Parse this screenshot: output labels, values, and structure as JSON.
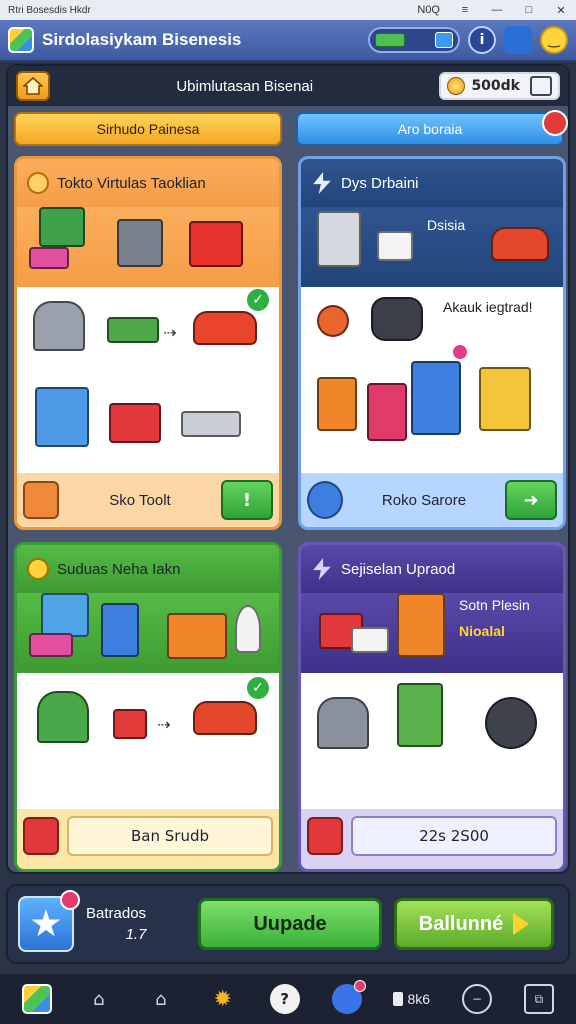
{
  "window": {
    "title": "Rtri Bosesdis Hkdr",
    "controls": [
      "N0Q",
      "≡",
      "—",
      "□",
      "✕"
    ]
  },
  "app": {
    "title": "Sirdolasiykam Bisenesis"
  },
  "subheader": {
    "title": "Ubimlutasan Bisenai",
    "coins": "500dk"
  },
  "tabs": {
    "left": "Sirhudo Painesa",
    "right": "Aro boraia"
  },
  "cards": [
    {
      "title": "Tokto Virtulas Taoklian",
      "footer_label": "Sko Toolt",
      "footer_button": "!"
    },
    {
      "title": "Dys Drbaini",
      "label_1": "Dsisia",
      "label_2": "Akauk iegtrad!",
      "footer_label": "Roko Sarore",
      "footer_button": "➜"
    },
    {
      "title": "Suduas Neha Iakn",
      "footer_label": "Ban Srudb"
    },
    {
      "title": "Sejiselan Upraod",
      "label_1": "Sotn Plesin",
      "label_2": "Nioalal",
      "footer_label": "22s 2S00"
    }
  ],
  "actionbar": {
    "stat_label": "Batrados",
    "stat_value": "1.7",
    "upgrade_label": "Uupade",
    "balance_label": "Ballunné"
  },
  "taskbar": {
    "count_label": "8k6"
  },
  "colors": {
    "accent_orange": "#f59c46",
    "accent_blue": "#2f5590",
    "accent_green": "#3e9b33",
    "accent_purple": "#3f3188"
  }
}
